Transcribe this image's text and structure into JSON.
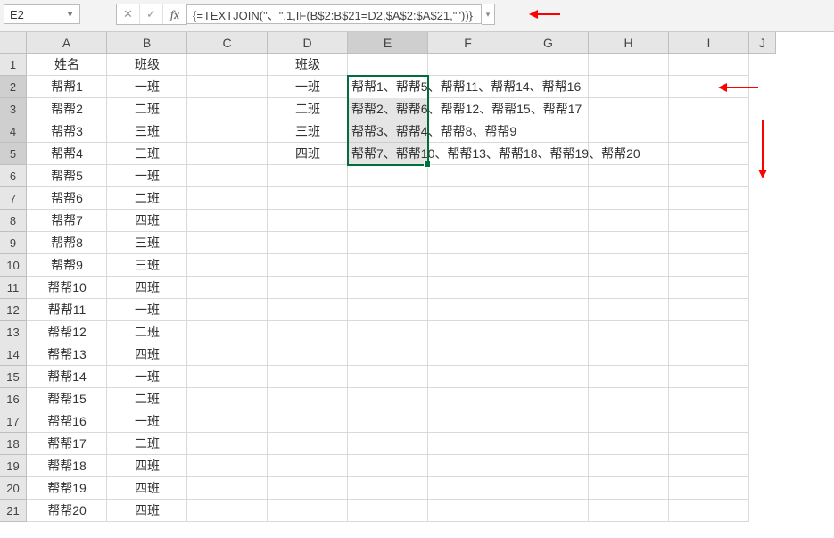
{
  "namebox": {
    "value": "E2"
  },
  "formula_bar": {
    "cancel_glyph": "✕",
    "confirm_glyph": "✓",
    "fx_label": "fx",
    "formula": "{=TEXTJOIN(\"、\",1,IF(B$2:B$21=D2,$A$2:$A$21,\"\"))}"
  },
  "columns": [
    "A",
    "B",
    "C",
    "D",
    "E",
    "F",
    "G",
    "H",
    "I"
  ],
  "last_col_partial": "J",
  "row_count": 21,
  "active_column": "E",
  "active_rows": [
    2,
    3,
    4,
    5
  ],
  "selection": {
    "top_row": 2,
    "bottom_row": 5,
    "col": "E",
    "active_row": 2
  },
  "headers": {
    "A1": "姓名",
    "B1": "班级",
    "D1": "班级"
  },
  "col_A": [
    "帮帮1",
    "帮帮2",
    "帮帮3",
    "帮帮4",
    "帮帮5",
    "帮帮6",
    "帮帮7",
    "帮帮8",
    "帮帮9",
    "帮帮10",
    "帮帮11",
    "帮帮12",
    "帮帮13",
    "帮帮14",
    "帮帮15",
    "帮帮16",
    "帮帮17",
    "帮帮18",
    "帮帮19",
    "帮帮20"
  ],
  "col_B": [
    "一班",
    "二班",
    "三班",
    "三班",
    "一班",
    "二班",
    "四班",
    "三班",
    "三班",
    "四班",
    "一班",
    "二班",
    "四班",
    "一班",
    "二班",
    "一班",
    "二班",
    "四班",
    "四班",
    "四班"
  ],
  "col_D": [
    "一班",
    "二班",
    "三班",
    "四班"
  ],
  "col_E": [
    "帮帮1、帮帮5、帮帮11、帮帮14、帮帮16",
    "帮帮2、帮帮6、帮帮12、帮帮15、帮帮17",
    "帮帮3、帮帮4、帮帮8、帮帮9",
    "帮帮7、帮帮10、帮帮13、帮帮18、帮帮19、帮帮20"
  ],
  "annotations": {
    "arrow_to_formula": true,
    "arrow_to_E2": true,
    "arrow_down_right": true
  }
}
